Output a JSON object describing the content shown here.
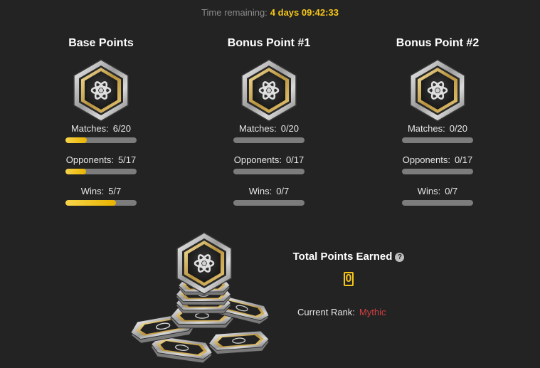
{
  "timer": {
    "label": "Time remaining:",
    "value": "4 days 09:42:33"
  },
  "columns": [
    {
      "title": "Base Points",
      "stats": [
        {
          "label": "Matches:",
          "value": "6/20",
          "progress": 0.3
        },
        {
          "label": "Opponents:",
          "value": "5/17",
          "progress": 0.29
        },
        {
          "label": "Wins:",
          "value": "5/7",
          "progress": 0.71
        }
      ]
    },
    {
      "title": "Bonus Point #1",
      "stats": [
        {
          "label": "Matches:",
          "value": "0/20",
          "progress": 0
        },
        {
          "label": "Opponents:",
          "value": "0/17",
          "progress": 0
        },
        {
          "label": "Wins:",
          "value": "0/7",
          "progress": 0
        }
      ]
    },
    {
      "title": "Bonus Point #2",
      "stats": [
        {
          "label": "Matches:",
          "value": "0/20",
          "progress": 0
        },
        {
          "label": "Opponents:",
          "value": "0/17",
          "progress": 0
        },
        {
          "label": "Wins:",
          "value": "0/7",
          "progress": 0
        }
      ]
    }
  ],
  "total": {
    "title": "Total Points Earned",
    "value": "0",
    "help_icon": "question-mark-icon"
  },
  "rank": {
    "label": "Current Rank:",
    "value": "Mythic"
  },
  "colors": {
    "accent": "#f5c518",
    "rank": "#d14040",
    "background": "#232323",
    "bar_track": "#7c7c7c"
  }
}
